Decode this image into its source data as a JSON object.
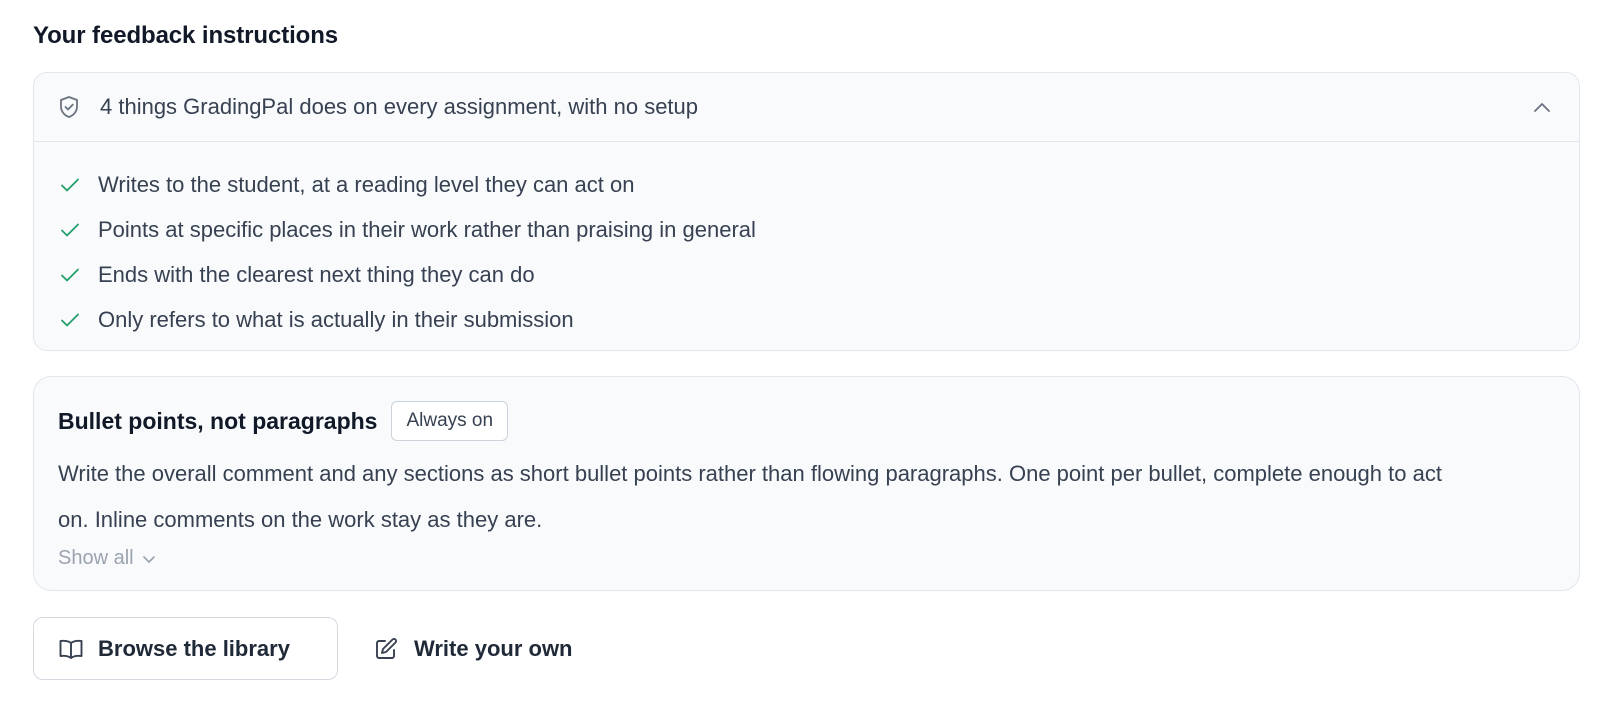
{
  "section": {
    "title": "Your feedback instructions"
  },
  "defaults": {
    "header": "4 things GradingPal does on every assignment, with no setup",
    "expanded": true,
    "items": [
      "Writes to the student, at a reading level they can act on",
      "Points at specific places in their work rather than praising in general",
      "Ends with the clearest next thing they can do",
      "Only refers to what is actually in their submission"
    ]
  },
  "instruction": {
    "title": "Bullet points, not paragraphs",
    "badge": "Always on",
    "body": "Write the overall comment and any sections as short bullet points rather than flowing paragraphs. One point per bullet, complete enough to act on. Inline comments on the work stay as they are.",
    "show_all": "Show all"
  },
  "actions": {
    "browse": "Browse the library",
    "write": "Write your own"
  },
  "icons": {
    "defaults_header": "shield-check-icon",
    "collapse": "chevron-up-icon",
    "check": "check-icon",
    "show_all": "chevron-down-icon",
    "browse": "book-open-icon",
    "write": "edit-icon"
  },
  "colors": {
    "check": "#22a06b",
    "card_bg": "#f8fafc",
    "border": "#e2e6ec",
    "muted": "#9aa3af"
  }
}
